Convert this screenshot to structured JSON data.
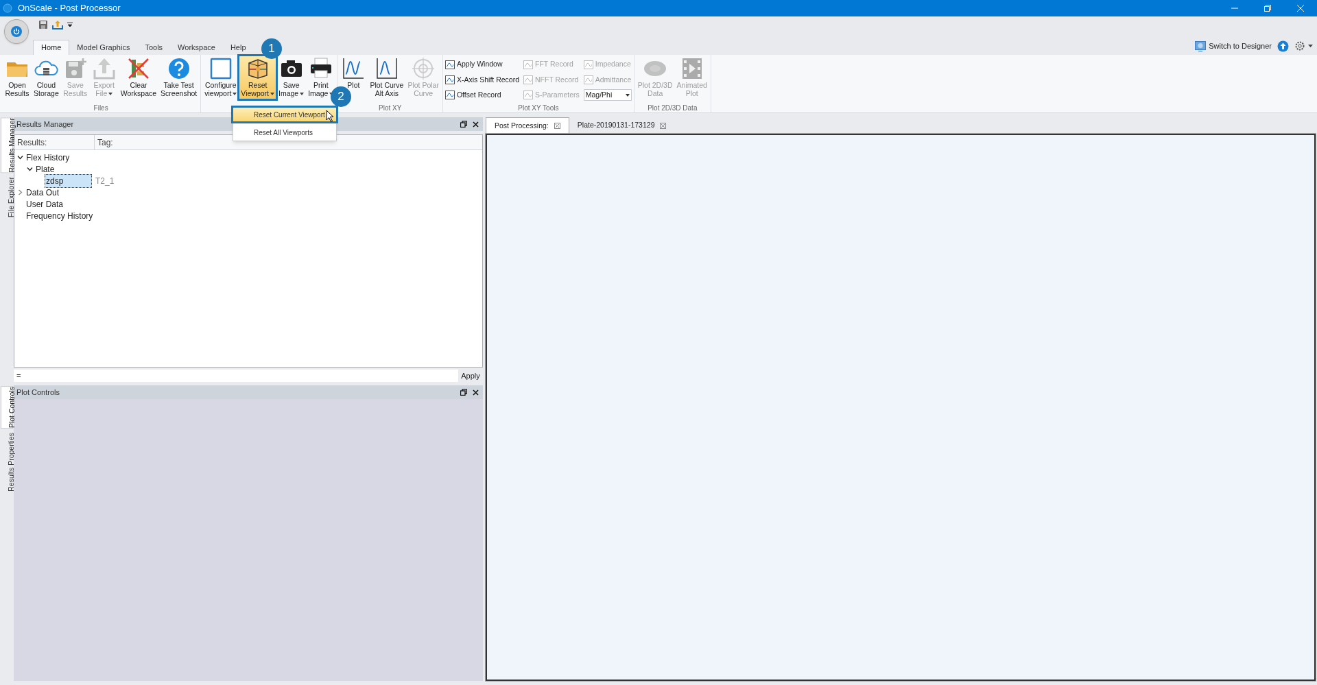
{
  "window": {
    "title": "OnScale - Post Processor"
  },
  "ribbon_tabs": [
    {
      "label": "Home",
      "selected": true
    },
    {
      "label": "Model Graphics",
      "selected": false
    },
    {
      "label": "Tools",
      "selected": false
    },
    {
      "label": "Workspace",
      "selected": false
    },
    {
      "label": "Help",
      "selected": false
    }
  ],
  "switch_designer": {
    "label": "Switch to Designer"
  },
  "ribbon_groups": [
    {
      "label": "Files",
      "items": [
        {
          "kind": "large",
          "lines": [
            "Open",
            "Results"
          ],
          "disabled": false,
          "dropdown": false,
          "pressed": false
        },
        {
          "kind": "large",
          "lines": [
            "Cloud",
            "Storage"
          ],
          "disabled": false,
          "dropdown": false,
          "pressed": false
        },
        {
          "kind": "large",
          "lines": [
            "Save",
            "Results"
          ],
          "disabled": true,
          "dropdown": false,
          "pressed": false
        },
        {
          "kind": "large",
          "lines": [
            "Export",
            "File"
          ],
          "disabled": true,
          "dropdown": true,
          "pressed": false
        },
        {
          "kind": "large",
          "lines": [
            "Clear",
            "Workspace"
          ],
          "disabled": false,
          "dropdown": false,
          "pressed": false
        },
        {
          "kind": "large",
          "lines": [
            "Take Test",
            "Screenshot"
          ],
          "disabled": false,
          "dropdown": false,
          "pressed": false
        }
      ]
    },
    {
      "items": [
        {
          "kind": "large",
          "lines": [
            "Configure",
            "viewport"
          ],
          "disabled": false,
          "dropdown": true,
          "pressed": false
        },
        {
          "kind": "large",
          "lines": [
            "Reset",
            "Viewport"
          ],
          "disabled": false,
          "dropdown": true,
          "pressed": true
        },
        {
          "kind": "large",
          "lines": [
            "Save",
            "Image"
          ],
          "disabled": false,
          "dropdown": true,
          "pressed": false
        },
        {
          "kind": "large",
          "lines": [
            "Print",
            "Image"
          ],
          "disabled": false,
          "dropdown": true,
          "pressed": false
        }
      ]
    },
    {
      "label": "Plot XY",
      "items": [
        {
          "kind": "large",
          "lines": [
            "Plot"
          ],
          "disabled": false,
          "dropdown": false,
          "pressed": false
        },
        {
          "kind": "large",
          "lines": [
            "Plot Curve",
            "Alt Axis"
          ],
          "disabled": false,
          "dropdown": false,
          "pressed": false
        },
        {
          "kind": "large",
          "lines": [
            "Plot Polar",
            "Curve"
          ],
          "disabled": true,
          "dropdown": false,
          "pressed": false
        }
      ]
    },
    {
      "label": "Plot XY Tools",
      "items": [
        {
          "kind": "small",
          "label": "Apply Window",
          "disabled": false
        },
        {
          "kind": "small",
          "label": "FFT Record",
          "disabled": true
        },
        {
          "kind": "small",
          "label": "Impedance",
          "disabled": true
        },
        {
          "kind": "small",
          "label": "X-Axis Shift Record",
          "disabled": false
        },
        {
          "kind": "small",
          "label": "NFFT Record",
          "disabled": true
        },
        {
          "kind": "small",
          "label": "Admittance",
          "disabled": true
        },
        {
          "kind": "small",
          "label": "Offset Record",
          "disabled": false
        },
        {
          "kind": "small",
          "label": "S-Parameters",
          "disabled": true
        },
        {
          "kind": "select",
          "value": "Mag/Phi"
        }
      ]
    },
    {
      "label": "Plot 2D/3D Data",
      "items": [
        {
          "kind": "large",
          "lines": [
            "Plot 2D/3D",
            "Data"
          ],
          "disabled": true,
          "dropdown": false,
          "pressed": false
        },
        {
          "kind": "large",
          "lines": [
            "Animated",
            "Plot"
          ],
          "disabled": true,
          "dropdown": false,
          "pressed": false
        }
      ]
    }
  ],
  "viewport_menu": {
    "items": [
      {
        "label": "Reset Current Viewport",
        "highlighted": true
      },
      {
        "label": "Reset All Viewports",
        "highlighted": false
      }
    ]
  },
  "callouts": [
    {
      "number": "1"
    },
    {
      "number": "2"
    }
  ],
  "side_tabs_top": [
    {
      "label": "Results Manager",
      "selected": true
    },
    {
      "label": "File Explorer",
      "selected": false
    }
  ],
  "side_tabs_bottom": [
    {
      "label": "Plot Controls",
      "selected": true
    },
    {
      "label": "Results Properties",
      "selected": false
    }
  ],
  "results_manager": {
    "title": "Results Manager",
    "columns": [
      "Results:",
      "Tag:"
    ],
    "tree": [
      {
        "label": "Flex History",
        "kind": "group",
        "expanded": true,
        "selected": false,
        "children": [
          {
            "label": "Plate",
            "kind": "group",
            "expanded": true,
            "selected": false,
            "children": [
              {
                "label": "zdsp",
                "kind": "leaf",
                "tag": "T2_1",
                "selected": true
              }
            ]
          }
        ]
      },
      {
        "label": "Data Out",
        "kind": "group",
        "expanded": false,
        "selected": false
      },
      {
        "label": "User Data",
        "kind": "leaf",
        "selected": false
      },
      {
        "label": "Frequency History",
        "kind": "leaf",
        "selected": false
      }
    ],
    "filter": {
      "value": "="
    },
    "apply_button": "Apply"
  },
  "plot_controls": {
    "title": "Plot Controls"
  },
  "document_tabs": [
    {
      "label": "Post Processing:",
      "selected": true
    },
    {
      "label": "Plate-20190131-173129",
      "selected": false
    }
  ]
}
